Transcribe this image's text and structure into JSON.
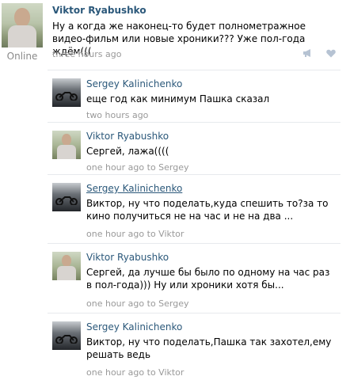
{
  "post": {
    "author": "Viktor Ryabushko",
    "status": "Online",
    "text": "Ну а когда же наконец-то будет полнометражное видео-фильм или новые хроники??? Уже пол-года ждём(((",
    "time": "three hours ago",
    "icons": [
      "megaphone-icon",
      "heart-icon"
    ]
  },
  "replies": [
    {
      "author": "Sergey Kalinichenko",
      "text": "еще год как минимум Пашка сказал",
      "time": "two hours ago",
      "to": ""
    },
    {
      "author": "Viktor Ryabushko",
      "text": "Сергей, лажа((((",
      "time": "one hour ago",
      "to": "to Sergey"
    },
    {
      "author": "Sergey Kalinichenko",
      "text": "Виктор, ну что поделать,куда спешить то?за то кино получиться не на час и не на два ...",
      "time": "one hour ago",
      "to": "to Viktor"
    },
    {
      "author": "Viktor Ryabushko",
      "text": "Сергей, да лучше бы было по одному на час раз в пол-года))) Ну или хроники хотя бы...",
      "time": "one hour ago",
      "to": "to Sergey"
    },
    {
      "author": "Sergey Kalinichenko",
      "text": "Виктор, ну что поделать,Пашка так захотел,ему решать ведь",
      "time": "one hour ago",
      "to": "to Viktor"
    }
  ]
}
